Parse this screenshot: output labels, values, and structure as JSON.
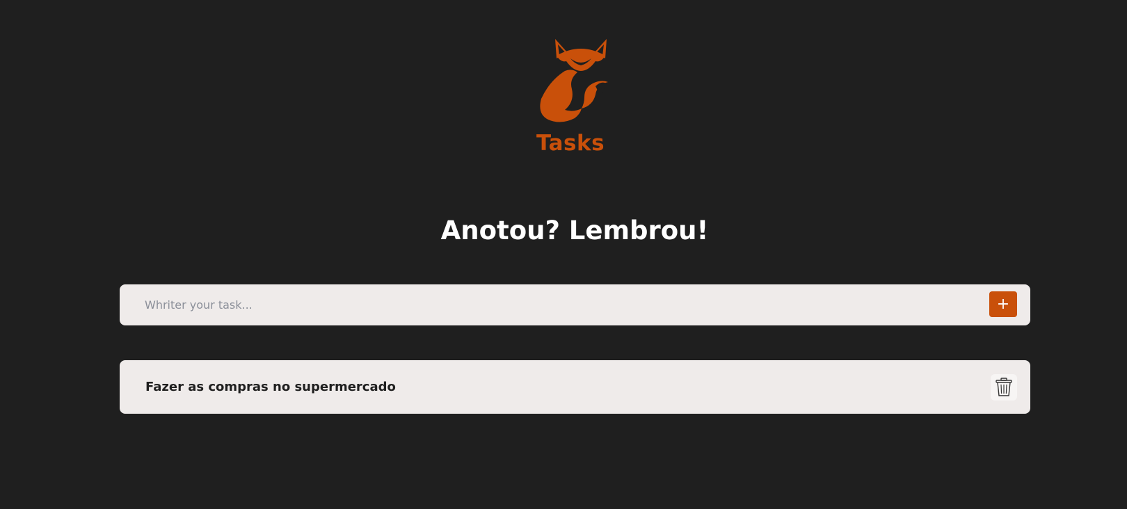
{
  "app": {
    "brand_name": "Tasks",
    "logo_icon": "fox-logo-icon",
    "accent_color": "#c9500a",
    "background_color": "#1f1f1f"
  },
  "header": {
    "headline": "Anotou? Lembrou!"
  },
  "form": {
    "input_placeholder": "Whriter your task...",
    "input_value": "",
    "add_button_label": "+"
  },
  "tasks": [
    {
      "text": "Fazer as compras no supermercado",
      "delete_icon": "trash-icon"
    }
  ]
}
